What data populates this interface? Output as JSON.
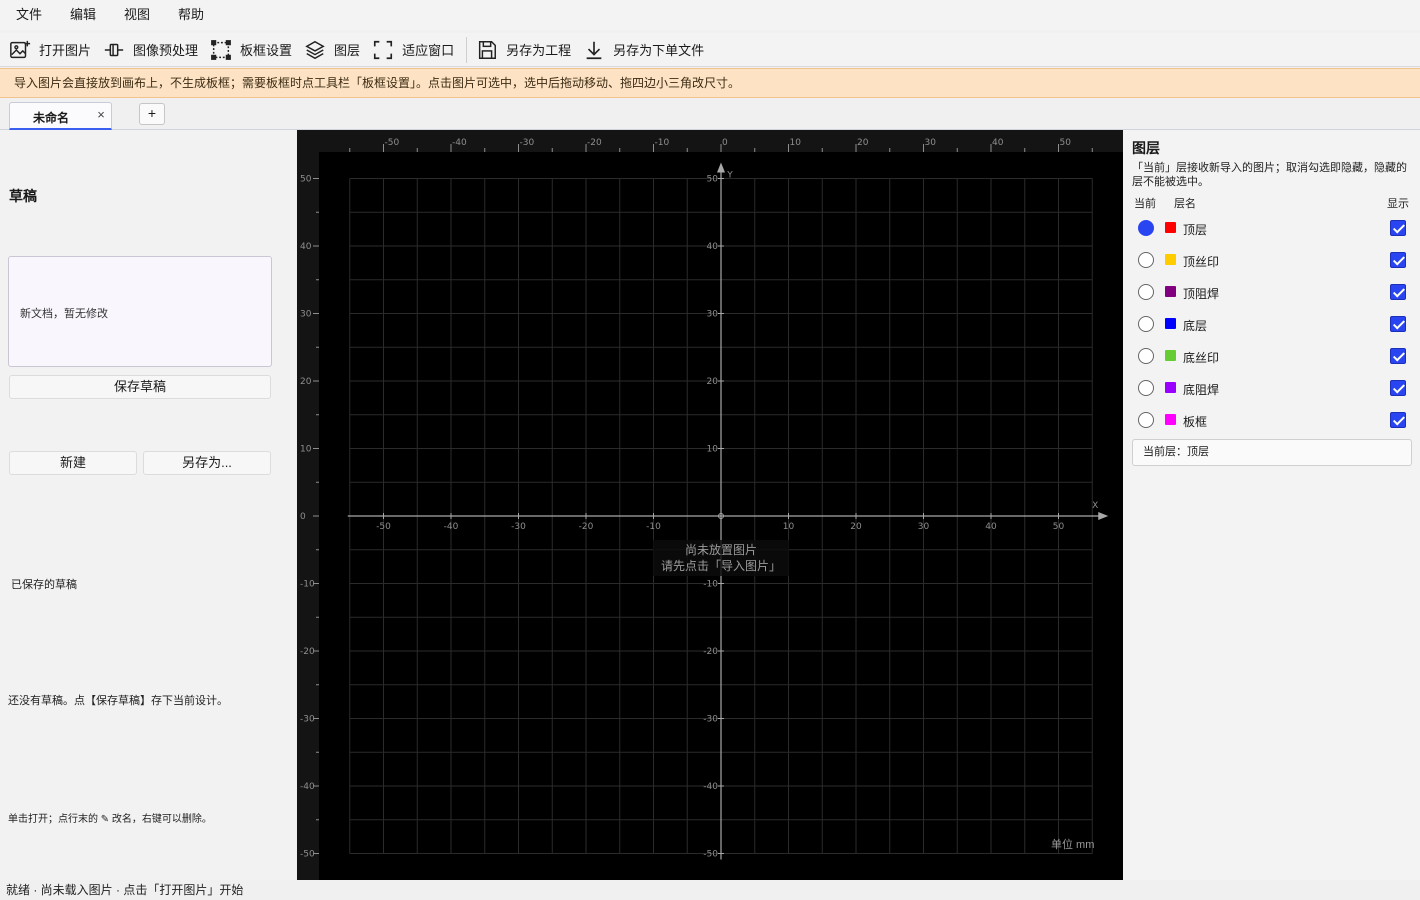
{
  "menubar": {
    "items": [
      "文件",
      "编辑",
      "视图",
      "帮助"
    ]
  },
  "toolbar": {
    "open_image": "打开图片",
    "preprocess": "图像预处理",
    "board_settings": "板框设置",
    "layers": "图层",
    "fit_window": "适应窗口",
    "save_project": "另存为工程",
    "save_order": "另存为下单文件"
  },
  "notice": "导入图片会直接放到画布上，不生成板框；需要板框时点工具栏「板框设置」。点击图片可选中，选中后拖动移动、拖四边小三角改尺寸。",
  "tabs": {
    "active_label": "未命名",
    "close": "×",
    "add": "+"
  },
  "left_panel": {
    "title": "草稿",
    "draft_status": "新文档，暂无修改",
    "save_draft": "保存草稿",
    "new_button": "新建",
    "save_as_button": "另存为...",
    "saved_drafts_label": "已保存的草稿",
    "no_drafts_text": "还没有草稿。点【保存草稿】存下当前设计。",
    "tip_text": "单击打开；点行末的 ✎ 改名，右键可以删除。"
  },
  "canvas": {
    "overlay_line1": "尚未放置图片",
    "overlay_line2": "请先点击「导入图片」",
    "unit_label": "单位 mm",
    "axis_x_label": "X",
    "axis_y_label": "Y",
    "ruler_ticks": [
      -50,
      -40,
      -30,
      -20,
      -10,
      0,
      10,
      20,
      30,
      40,
      50
    ],
    "colors": {
      "background": "#000000",
      "grid": "#2b2b2b",
      "axis": "#a8a8a8",
      "text": "#8e8e8e"
    }
  },
  "right_panel": {
    "title": "图层",
    "description": "「当前」层接收新导入的图片；取消勾选即隐藏，隐藏的层不能被选中。",
    "col_current": "当前",
    "col_name": "层名",
    "col_show": "显示",
    "layers": [
      {
        "name": "顶层",
        "color": "#ff0000",
        "current": true,
        "visible": true
      },
      {
        "name": "顶丝印",
        "color": "#ffcc00",
        "current": false,
        "visible": true
      },
      {
        "name": "顶阻焊",
        "color": "#800080",
        "current": false,
        "visible": true
      },
      {
        "name": "底层",
        "color": "#0000ff",
        "current": false,
        "visible": true
      },
      {
        "name": "底丝印",
        "color": "#66cc33",
        "current": false,
        "visible": true
      },
      {
        "name": "底阻焊",
        "color": "#9900ff",
        "current": false,
        "visible": true
      },
      {
        "name": "板框",
        "color": "#ff00ff",
        "current": false,
        "visible": true
      }
    ],
    "current_layer_text": "当前层：顶层"
  },
  "statusbar": {
    "text": "就绪 · 尚未载入图片 · 点击「打开图片」开始"
  }
}
